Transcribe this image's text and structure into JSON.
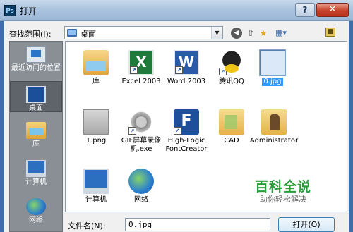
{
  "window": {
    "title": "打开",
    "app_icon": "Ps",
    "help": "?",
    "close": "✕"
  },
  "toolbar": {
    "lookin_label": "查找范围(I):",
    "lookin_value": "桌面",
    "icons": [
      "back-icon",
      "up-folder-icon",
      "new-folder-icon",
      "view-menu-icon",
      "desktop-icon"
    ]
  },
  "places": [
    {
      "label": "最近访问的位置",
      "icon": "recent-places-icon"
    },
    {
      "label": "桌面",
      "icon": "desktop-icon",
      "active": true
    },
    {
      "label": "库",
      "icon": "libraries-icon"
    },
    {
      "label": "计算机",
      "icon": "computer-icon"
    },
    {
      "label": "网络",
      "icon": "network-icon"
    }
  ],
  "files": [
    {
      "label": "库",
      "icon": "libraries-icon"
    },
    {
      "label": "Excel 2003",
      "icon": "excel-icon",
      "shortcut": true
    },
    {
      "label": "Word 2003",
      "icon": "word-icon",
      "shortcut": true
    },
    {
      "label": "腾讯QQ",
      "icon": "qq-icon",
      "shortcut": true
    },
    {
      "label": "0.jpg",
      "icon": "image-icon",
      "selected": true
    },
    {
      "label": "1.png",
      "icon": "image-icon"
    },
    {
      "label": "GIF屏幕录像机.exe",
      "icon": "gif-recorder-icon",
      "shortcut": true
    },
    {
      "label": "High-Logic FontCreator",
      "icon": "fontcreator-icon",
      "shortcut": true
    },
    {
      "label": "CAD",
      "icon": "folder-icon"
    },
    {
      "label": "Administrator",
      "icon": "user-folder-icon"
    },
    {
      "label": "计算机",
      "icon": "computer-icon"
    },
    {
      "label": "网络",
      "icon": "network-icon"
    }
  ],
  "bottom": {
    "filename_label": "文件名(N):",
    "filename_value": "0.jpg",
    "open_label": "打开(O)"
  },
  "watermark": {
    "title": "百科全说",
    "subtitle": "助你轻松解决"
  }
}
